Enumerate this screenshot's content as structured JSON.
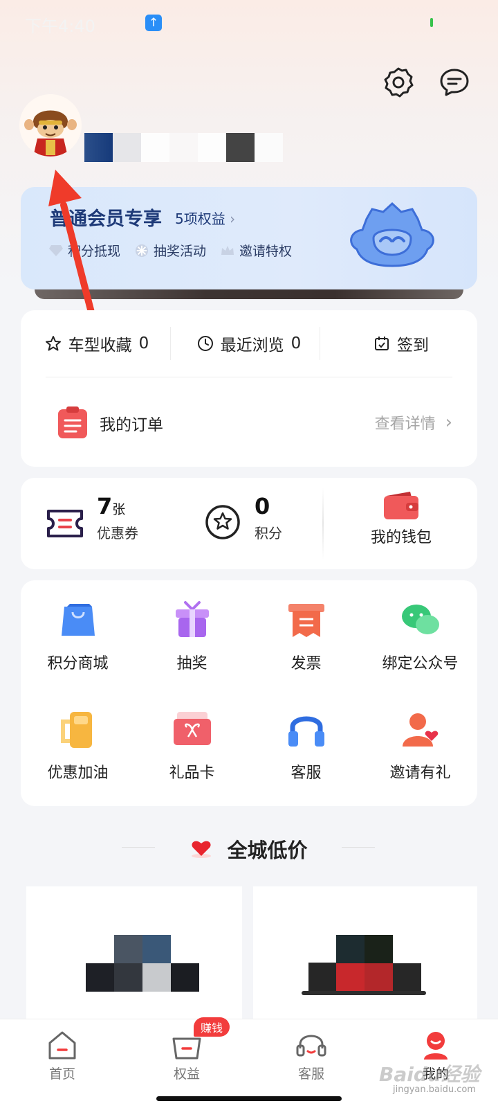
{
  "status": {
    "time": "下午4:40"
  },
  "header": {
    "settings_icon": "gear-icon",
    "message_icon": "chat-icon"
  },
  "member": {
    "title": "普通会员专享",
    "benefits_link": "5项权益",
    "features": [
      {
        "icon": "diamond-icon",
        "label": "积分抵现"
      },
      {
        "icon": "snowflake-icon",
        "label": "抽奖活动"
      },
      {
        "icon": "crown-icon",
        "label": "邀请特权"
      }
    ]
  },
  "stats": {
    "favorites": {
      "label": "车型收藏",
      "count": "0"
    },
    "recent": {
      "label": "最近浏览",
      "count": "0"
    },
    "checkin": {
      "label": "签到"
    }
  },
  "order": {
    "label": "我的订单",
    "detail": "查看详情"
  },
  "wallet": {
    "coupon": {
      "value": "7",
      "unit": "张",
      "label": "优惠券"
    },
    "points": {
      "value": "0",
      "label": "积分"
    },
    "purse": {
      "label": "我的钱包"
    }
  },
  "grid": [
    {
      "icon": "shopping-bag-icon",
      "label": "积分商城"
    },
    {
      "icon": "gift-box-icon",
      "label": "抽奖"
    },
    {
      "icon": "invoice-icon",
      "label": "发票"
    },
    {
      "icon": "wechat-icon",
      "label": "绑定公众号"
    },
    {
      "icon": "fuel-icon",
      "label": "优惠加油"
    },
    {
      "icon": "gift-card-icon",
      "label": "礼品卡"
    },
    {
      "icon": "headset-icon",
      "label": "客服"
    },
    {
      "icon": "invite-icon",
      "label": "邀请有礼"
    }
  ],
  "section": {
    "title": "全城低价"
  },
  "tabs": [
    {
      "icon": "home-icon",
      "label": "首页"
    },
    {
      "icon": "benefits-icon",
      "label": "权益",
      "badge": "赚钱"
    },
    {
      "icon": "service-icon",
      "label": "客服"
    },
    {
      "icon": "profile-icon",
      "label": "我的"
    }
  ],
  "watermark": {
    "brand": "Baidu经验",
    "url": "jingyan.baidu.com"
  },
  "colors": {
    "accent": "#f23c3c",
    "member_text": "#1e3a78",
    "card_bg": "#ffffff"
  }
}
